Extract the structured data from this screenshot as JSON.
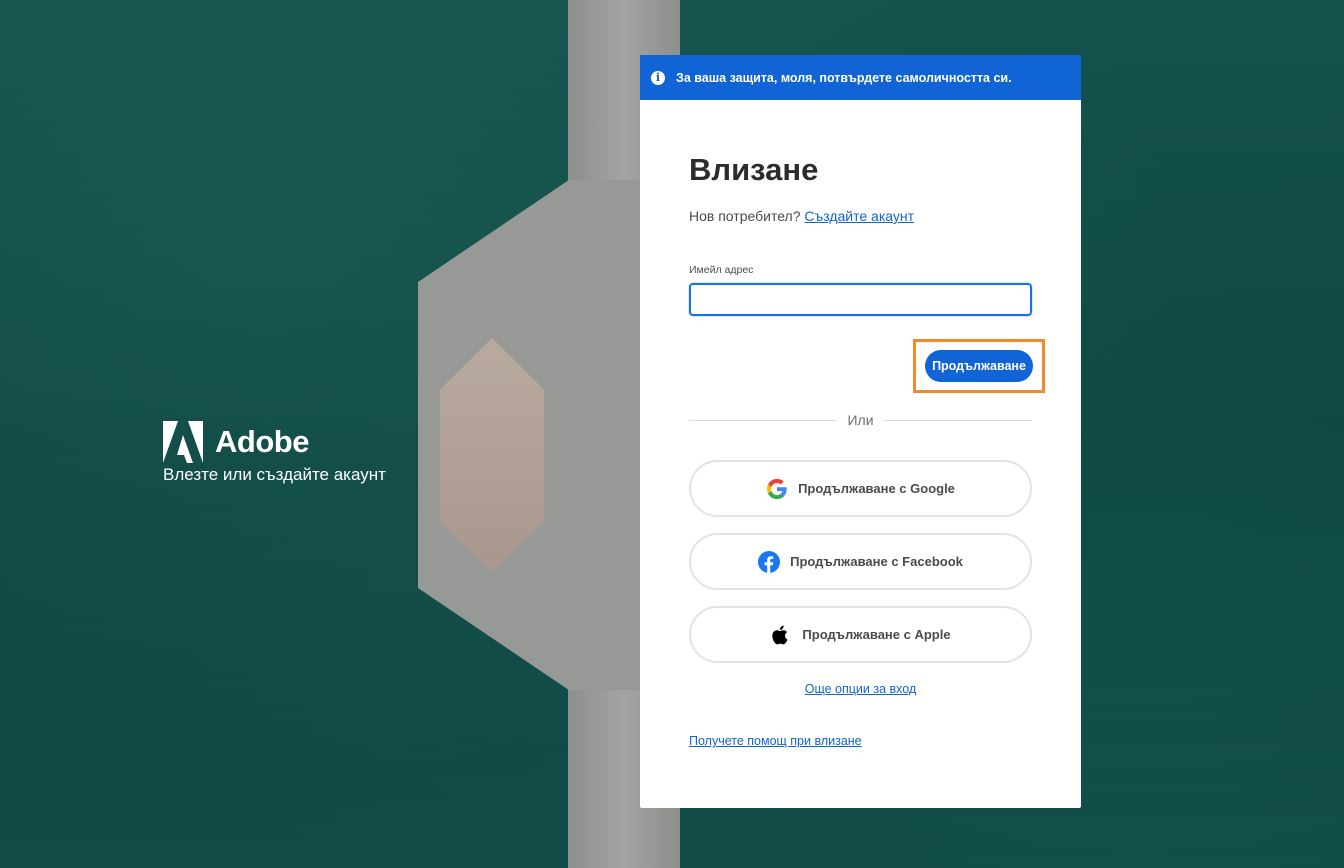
{
  "banner": {
    "text": "За ваша защита, моля, потвърдете самоличността си.",
    "icon": "info-icon"
  },
  "brand": {
    "name": "Adobe",
    "tagline": "Влезте или създайте акаунт",
    "logo": "adobe-logo"
  },
  "signin": {
    "title": "Влизане",
    "new_user_text": "Нов потребител?",
    "create_account_link": "Създайте акаунт",
    "email_label": "Имейл адрес",
    "email_value": "",
    "continue_label": "Продължаване",
    "divider_text": "Или",
    "social": {
      "google": "Продължаване с Google",
      "facebook": "Продължаване с Facebook",
      "apple": "Продължаване с Apple"
    },
    "more_options_link": "Още опции за вход",
    "help_link": "Получете помощ при влизане"
  },
  "colors": {
    "accent": "#1064d6",
    "highlight": "#f08a2a",
    "background": "#0f4a47"
  }
}
